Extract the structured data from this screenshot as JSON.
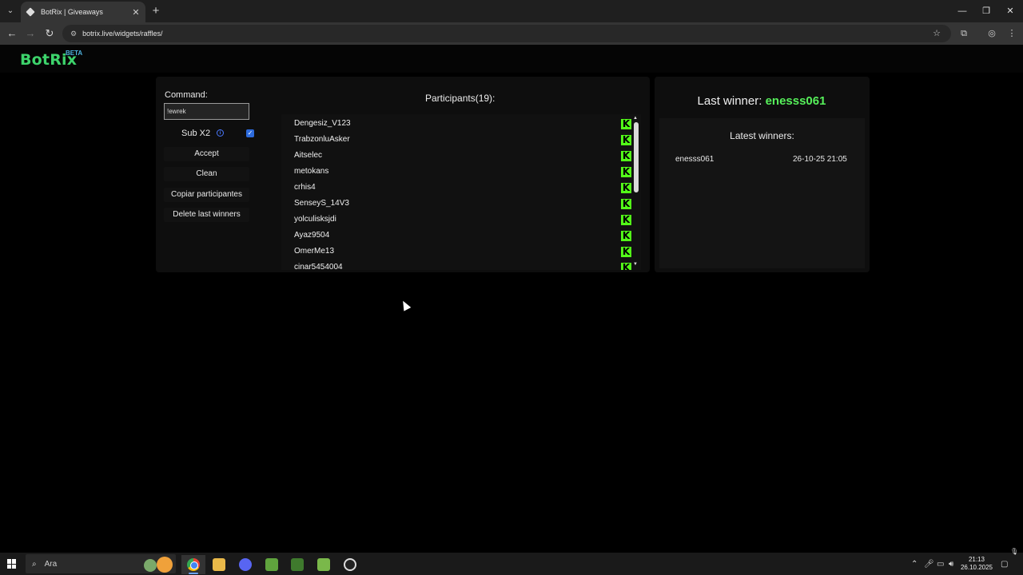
{
  "browser": {
    "tab_title": "BotRix | Giveaways",
    "url": "botrix.live/widgets/raffles/",
    "new_tab": "+",
    "tab_close": "✕"
  },
  "site": {
    "logo": "BotRix",
    "beta": "BETA"
  },
  "controls": {
    "command_label": "Command:",
    "command_value": "!ewrek",
    "sub_label": "Sub X2",
    "sub_checked": true,
    "buttons": [
      "Accept",
      "Clean",
      "Copiar participantes",
      "Delete last winners"
    ]
  },
  "participants": {
    "title": "Participants(19):",
    "items": [
      "Dengesiz_V123",
      "TrabzonluAsker",
      "Aitselec",
      "metokans",
      "crhis4",
      "SenseyS_14V3",
      "yolculisksjdi",
      "Ayaz9504",
      "OmerMe13",
      "cinar5454004"
    ],
    "platform_icon": "kick-icon"
  },
  "winners": {
    "last_winner_label": "Last winner:",
    "last_winner_name": "enesss061",
    "latest_title": "Latest winners:",
    "list": [
      {
        "name": "enesss061",
        "date": "26-10-25 21:05"
      }
    ]
  },
  "taskbar": {
    "search_placeholder": "Ara",
    "time": "21:13",
    "date": "26.10.2025"
  },
  "colors": {
    "brand_green": "#3dd36b",
    "winner_green": "#56f05a",
    "kick_green": "#53fc18",
    "beta_blue": "#4fb4e0"
  }
}
